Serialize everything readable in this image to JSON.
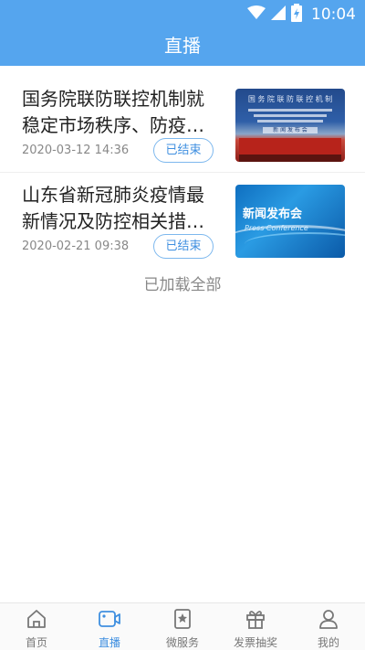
{
  "status_bar": {
    "time": "10:04"
  },
  "header": {
    "title": "直播"
  },
  "items": [
    {
      "title": "国务院联防联控机制就稳定市场秩序、防疫…",
      "date": "2020-03-12 14:36",
      "badge": "已结束",
      "thumbnail": {
        "line1": "国 务 院 联 防 联 控 机 制",
        "line2": "新 闻 发 布 会"
      }
    },
    {
      "title": "山东省新冠肺炎疫情最新情况及防控相关措…",
      "date": "2020-02-21 09:38",
      "badge": "已结束",
      "thumbnail": {
        "big": "新闻发布会",
        "sub": "Press Conference"
      }
    }
  ],
  "footer_text": "已加载全部",
  "tabs": [
    {
      "label": "首页",
      "icon": "home-icon",
      "active": false
    },
    {
      "label": "直播",
      "icon": "video-icon",
      "active": true
    },
    {
      "label": "微服务",
      "icon": "bookmark-star-icon",
      "active": false
    },
    {
      "label": "发票抽奖",
      "icon": "gift-icon",
      "active": false
    },
    {
      "label": "我的",
      "icon": "user-icon",
      "active": false
    }
  ],
  "colors": {
    "primary": "#55a5ee",
    "accent": "#3f8fe0",
    "text": "#222222",
    "muted": "#888888"
  }
}
